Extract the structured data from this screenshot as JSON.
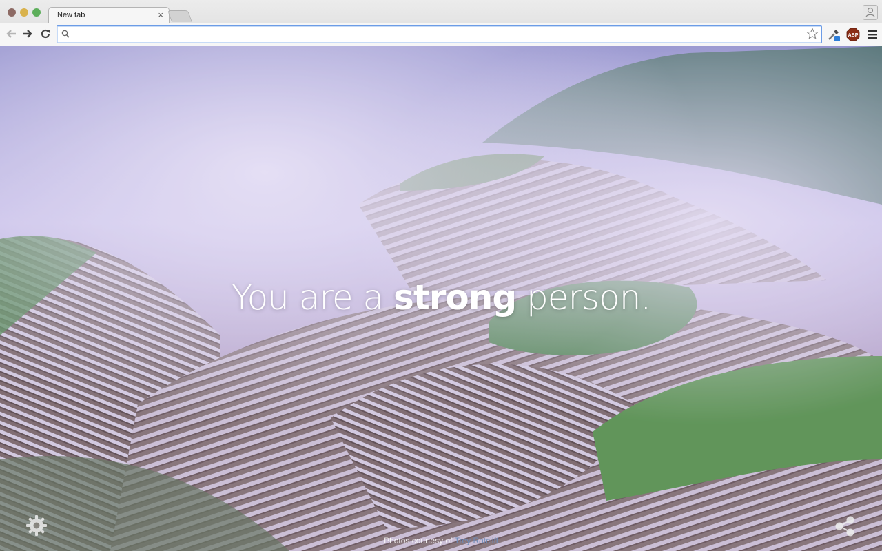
{
  "browser": {
    "tab": {
      "title": "New tab",
      "close_glyph": "×"
    },
    "address_bar": {
      "value": "",
      "placeholder": ""
    },
    "extensions": [
      "eyedropper-icon",
      "adblock-plus-icon",
      "menu-icon"
    ],
    "extension_labels": {
      "abp": "ABP"
    }
  },
  "page": {
    "quote_pre": "You are a ",
    "quote_bold": "strong",
    "quote_post": " person.",
    "credit_prefix": "Photos courtesy of ",
    "credit_link": "Trey Ratcliff"
  },
  "colors": {
    "accent": "#6c9ce6",
    "quote_text": "#ffffff"
  }
}
